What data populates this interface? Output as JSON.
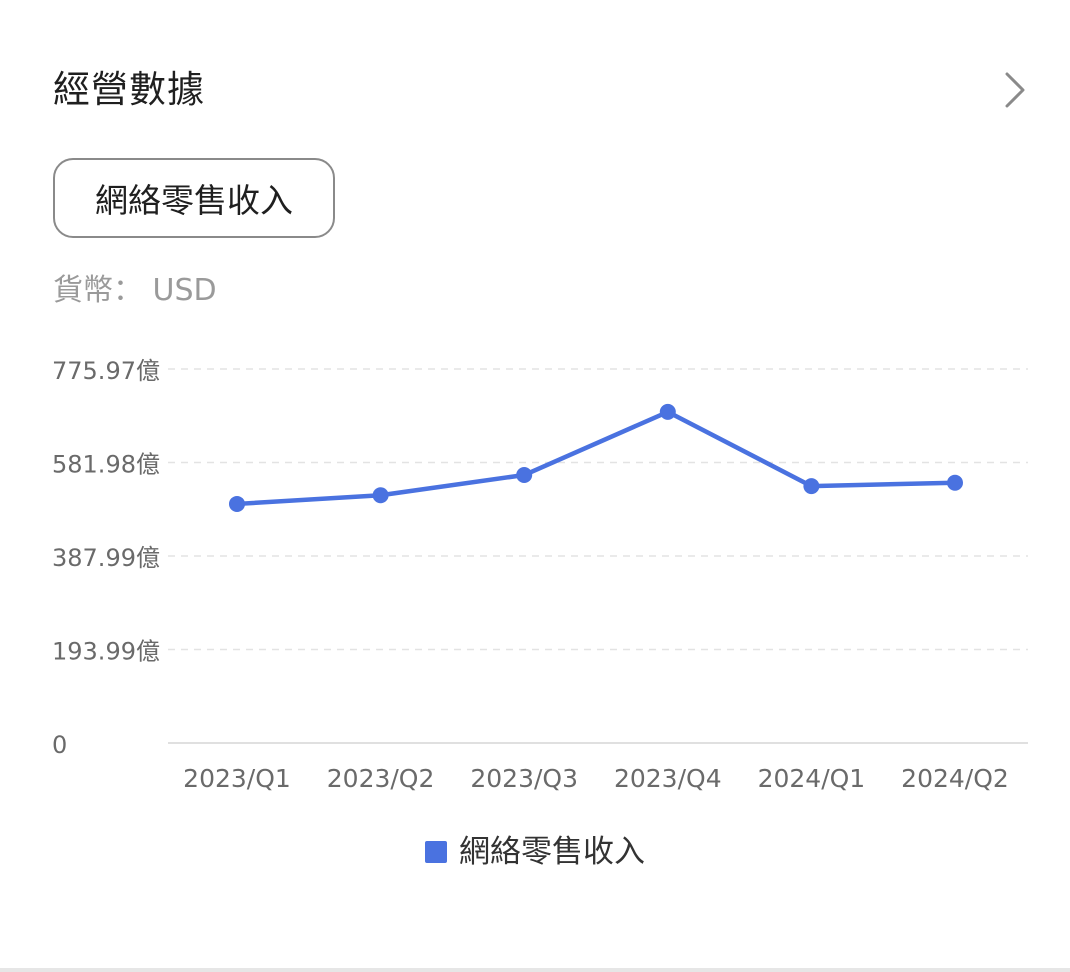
{
  "header": {
    "title": "經營數據",
    "more_icon": "chevron-right-icon"
  },
  "metric_button": {
    "label": "網絡零售收入"
  },
  "currency": {
    "label": "貨幣：",
    "value": "USD"
  },
  "colors": {
    "series": "#4a72e0",
    "grid": "#e3e3e3",
    "axis_text": "#6a6a6a",
    "muted_text": "#9a9a9a"
  },
  "chart_data": {
    "type": "line",
    "categories": [
      "2023/Q1",
      "2023/Q2",
      "2023/Q3",
      "2023/Q4",
      "2024/Q1",
      "2024/Q2"
    ],
    "series": [
      {
        "name": "網絡零售收入",
        "values": [
          496,
          514,
          556,
          687,
          533,
          540
        ]
      }
    ],
    "yticks": [
      0,
      193.99,
      387.99,
      581.98,
      775.97
    ],
    "ytick_labels": [
      "0",
      "193.99億",
      "387.99億",
      "581.98億",
      "775.97億"
    ],
    "ylim": [
      0,
      775.97
    ],
    "grid": true,
    "legend_position": "bottom-center",
    "markers": true
  }
}
